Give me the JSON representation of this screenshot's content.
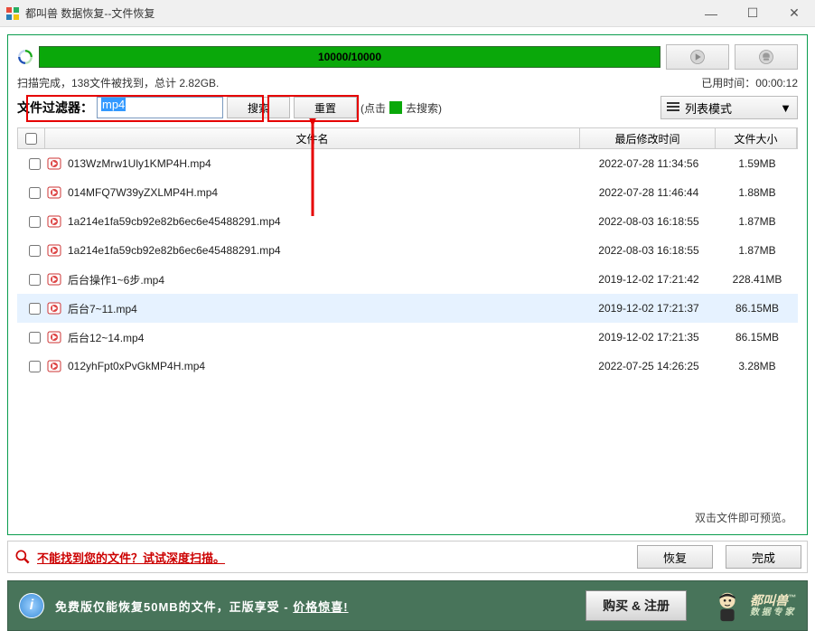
{
  "window": {
    "title": "都叫兽 数据恢复--文件恢复"
  },
  "progress": {
    "text": "10000/10000"
  },
  "status": {
    "scan_summary": "扫描完成，138文件被找到，总计 2.82GB.",
    "elapsed_label": "已用时间：",
    "elapsed_value": "00:00:12"
  },
  "filter": {
    "label": "文件过滤器：",
    "value": "mp4",
    "search_btn": "搜索",
    "reset_btn": "重置",
    "hint_prefix": "(点击",
    "hint_suffix": "去搜索)",
    "view_mode": "列表模式"
  },
  "columns": {
    "name": "文件名",
    "date": "最后修改时间",
    "size": "文件大小"
  },
  "rows": [
    {
      "name": "013WzMrw1Uly1KMP4H.mp4",
      "date": "2022-07-28 11:34:56",
      "size": "1.59MB",
      "hl": false
    },
    {
      "name": "014MFQ7W39yZXLMP4H.mp4",
      "date": "2022-07-28 11:46:44",
      "size": "1.88MB",
      "hl": false
    },
    {
      "name": "1a214e1fa59cb92e82b6ec6e45488291.mp4",
      "date": "2022-08-03 16:18:55",
      "size": "1.87MB",
      "hl": false
    },
    {
      "name": "1a214e1fa59cb92e82b6ec6e45488291.mp4",
      "date": "2022-08-03 16:18:55",
      "size": "1.87MB",
      "hl": false
    },
    {
      "name": "后台操作1~6步.mp4",
      "date": "2019-12-02 17:21:42",
      "size": "228.41MB",
      "hl": false
    },
    {
      "name": "后台7~11.mp4",
      "date": "2019-12-02 17:21:37",
      "size": "86.15MB",
      "hl": true
    },
    {
      "name": "后台12~14.mp4",
      "date": "2019-12-02 17:21:35",
      "size": "86.15MB",
      "hl": false
    },
    {
      "name": "012yhFpt0xPvGkMP4H.mp4",
      "date": "2022-07-25 14:26:25",
      "size": "3.28MB",
      "hl": false
    }
  ],
  "preview_hint": "双击文件即可预览。",
  "deep_scan": "不能找到您的文件？试试深度扫描。",
  "buttons": {
    "recover": "恢复",
    "done": "完成",
    "buy": "购买 & 注册"
  },
  "banner": {
    "text_prefix": "免费版仅能恢复50MB的文件，正版享受 - ",
    "link_text": "价格惊喜!",
    "brand": "都叫兽",
    "brand_sub": "数 据 专 家"
  }
}
